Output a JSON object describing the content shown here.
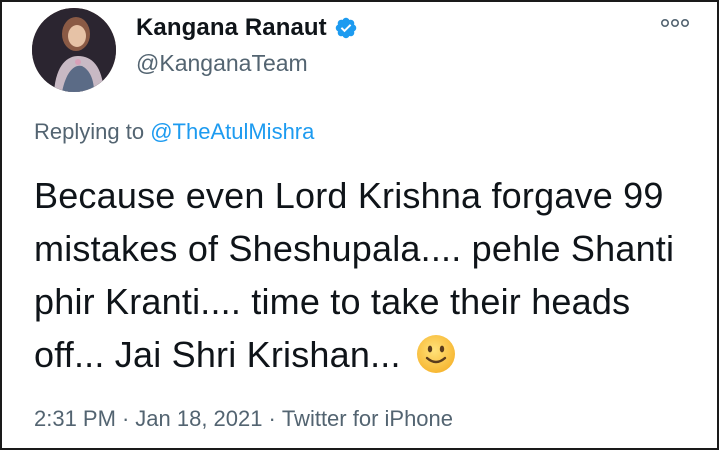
{
  "author": {
    "display_name": "Kangana Ranaut",
    "handle": "@KanganaTeam",
    "verified": true,
    "verified_icon": "verified-badge-icon",
    "verified_color": "#1d9bf0"
  },
  "reply": {
    "prefix": "Replying to",
    "mention": "@TheAtulMishra"
  },
  "tweet": {
    "text": "Because even Lord Krishna forgave 99 mistakes of Sheshupala.... pehle Shanti phir Kranti.... time to take their heads off... Jai Shri Krishan...",
    "emoji": "slightly-smiling-face"
  },
  "meta": {
    "time": "2:31 PM",
    "date": "Jan 18, 2021",
    "source": "Twitter for iPhone",
    "separator": "·"
  },
  "colors": {
    "text": "#0f1419",
    "secondary": "#536471",
    "link": "#1d9bf0"
  }
}
